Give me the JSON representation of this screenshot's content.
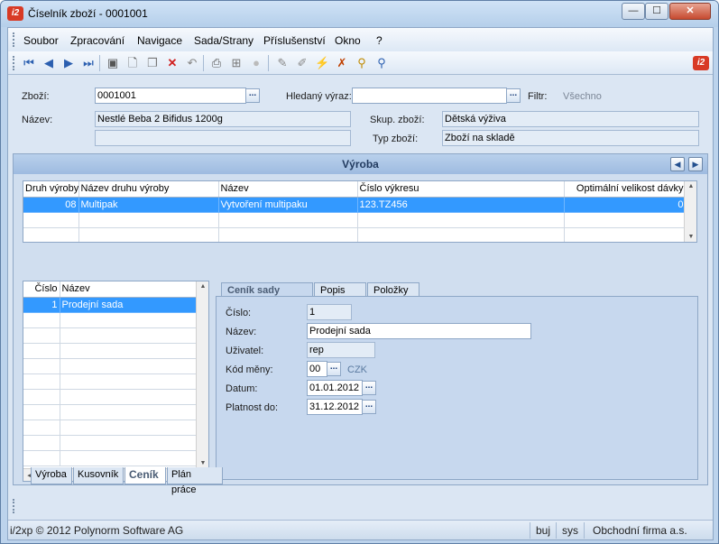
{
  "window": {
    "title": "Číselník zboží - 0001001",
    "logo": "i2",
    "buttons": {
      "minimize": "—",
      "maximize": "☐",
      "close": "✕"
    }
  },
  "menu": [
    "Soubor",
    "Zpracování",
    "Navigace",
    "Sada/Strany",
    "Příslušenství",
    "Okno",
    "?"
  ],
  "toolbar_icons": [
    "first-icon",
    "prev-icon",
    "next-icon",
    "last-icon",
    "save-icon",
    "new-icon",
    "copy-icon",
    "delete-icon",
    "undo-icon",
    "print-icon",
    "tree-icon",
    "disabled-icon",
    "edit-icon",
    "edit2-icon",
    "filter-icon",
    "filter-clear-icon",
    "search-icon",
    "search-advanced-icon"
  ],
  "form": {
    "zbozi_label": "Zboží:",
    "zbozi_value": "0001001",
    "hledany_label": "Hledaný výraz:",
    "hledany_value": "",
    "filtr_label": "Filtr:",
    "filtr_value": "Všechno",
    "nazev_label": "Název:",
    "nazev_value": "Nestlé Beba 2 Bifidus 1200g",
    "nazev2_value": "",
    "skup_label": "Skup. zboží:",
    "skup_value": "Dětská výživa",
    "typ_label": "Typ zboží:",
    "typ_value": "Zboží na skladě",
    "dots": "..."
  },
  "vyroba": {
    "title": "Výroba",
    "columns": [
      "Druh výroby",
      "Název druhu výroby",
      "Název",
      "Číslo výkresu",
      "Optimální velikost dávky"
    ],
    "rows": [
      [
        "08",
        "Multipak",
        "Vytvoření multipaku",
        "123.TZ456",
        "0"
      ]
    ]
  },
  "sada_list": {
    "columns": [
      "Číslo",
      "Název"
    ],
    "rows": [
      [
        "1",
        "Prodejní sada"
      ]
    ]
  },
  "tabs": [
    "Ceník sady",
    "Popis",
    "Položky"
  ],
  "cenik": {
    "cislo_label": "Číslo:",
    "cislo_value": "1",
    "nazev_label": "Název:",
    "nazev_value": "Prodejní sada",
    "uzivatel_label": "Uživatel:",
    "uzivatel_value": "rep",
    "kod_meny_label": "Kód měny:",
    "kod_meny_value": "00",
    "mena_text": "CZK",
    "datum_label": "Datum:",
    "datum_value": "01.01.2012",
    "platnost_label": "Platnost do:",
    "platnost_value": "31.12.2012"
  },
  "bottom_tabs": [
    "Výroba",
    "Kusovník",
    "Ceník",
    "Plán práce"
  ],
  "status": {
    "copyright": "i/2xp © 2012 Polynorm Software AG",
    "user": "buj",
    "db": "sys",
    "company": "Obchodní firma a.s."
  }
}
